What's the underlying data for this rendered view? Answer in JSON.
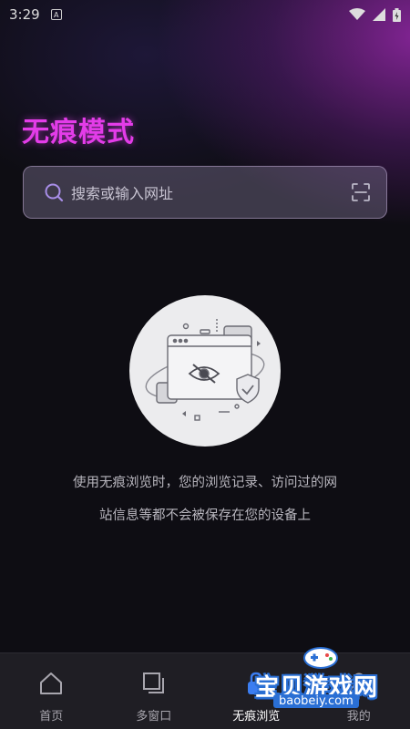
{
  "status_bar": {
    "time": "3:29",
    "notif_icon": "a-notification-icon"
  },
  "page": {
    "title": "无痕模式"
  },
  "search": {
    "placeholder": "搜索或输入网址"
  },
  "description": {
    "line1": "使用无痕浏览时，您的浏览记录、访问过的网",
    "line2": "站信息等都不会被保存在您的设备上"
  },
  "bottom_nav": {
    "items": [
      {
        "label": "首页",
        "icon": "home-icon"
      },
      {
        "label": "多窗口",
        "icon": "windows-icon"
      },
      {
        "label": "无痕浏览",
        "icon": "incognito-lock-icon",
        "active": true
      },
      {
        "label": "我的",
        "icon": "profile-icon"
      }
    ]
  },
  "watermark": {
    "text": "宝贝游戏网",
    "domain": "baobeiy.com"
  },
  "colors": {
    "accent": "#e33ce8",
    "background": "#0e0d13",
    "nav_bg": "#1f1e24"
  }
}
